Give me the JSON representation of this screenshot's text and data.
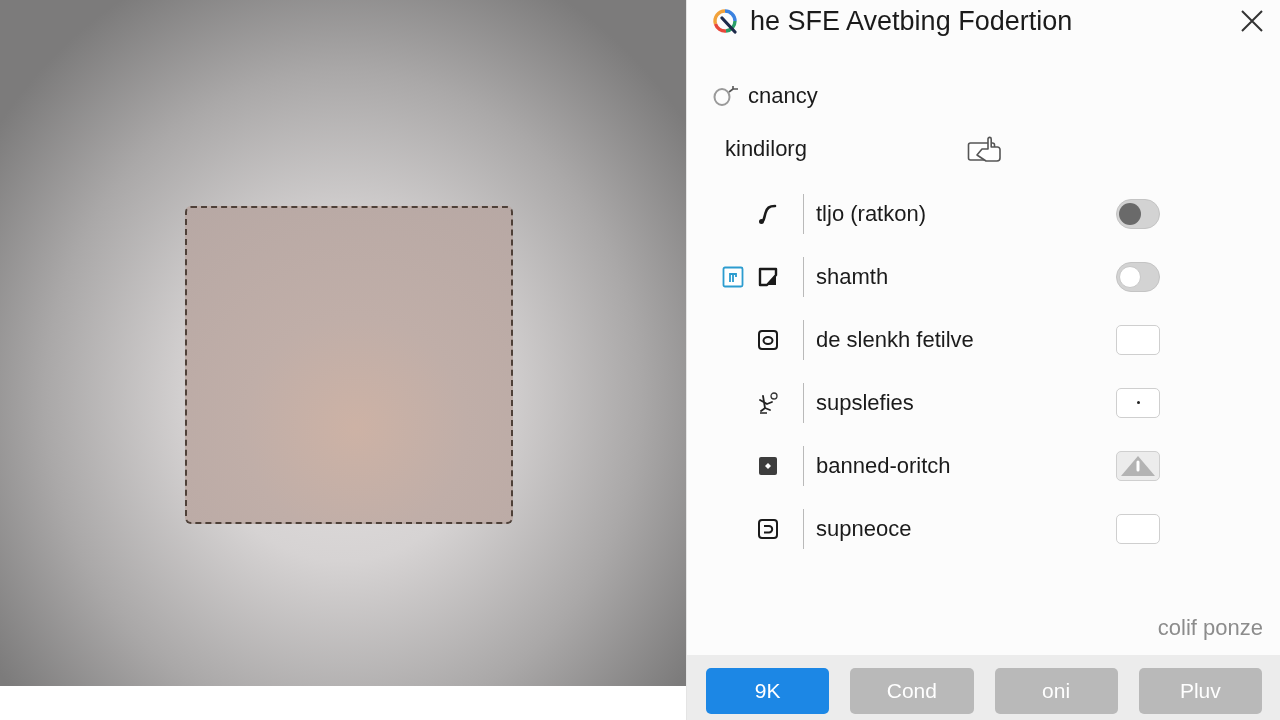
{
  "window": {
    "title": "he SFE Avetbing Fodertion"
  },
  "profile": {
    "label": "cnancy"
  },
  "group": {
    "label": "kindilorg"
  },
  "options": [
    {
      "label": "tljo (ratkon)",
      "kind": "switch",
      "checked": false,
      "marked": false
    },
    {
      "label": "shamth",
      "kind": "toggle",
      "checked": false,
      "marked": true
    },
    {
      "label": "de slenkh fetilve",
      "kind": "field",
      "marked": false
    },
    {
      "label": "supslefies",
      "kind": "dot",
      "marked": false
    },
    {
      "label": "banned-oritch",
      "kind": "warning",
      "marked": false
    },
    {
      "label": "supneoce",
      "kind": "field",
      "marked": false
    }
  ],
  "note": "colif ponze",
  "buttons": [
    {
      "label": "9K",
      "primary": true
    },
    {
      "label": "Cond",
      "primary": false
    },
    {
      "label": "oni",
      "primary": false
    },
    {
      "label": "Pluv",
      "primary": false
    }
  ]
}
